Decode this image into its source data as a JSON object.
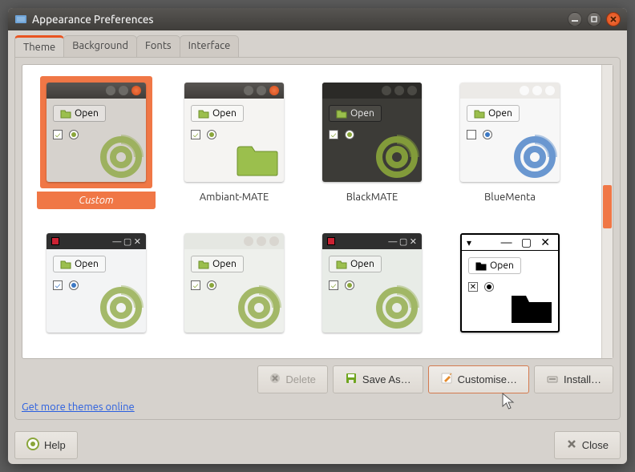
{
  "window": {
    "title": "Appearance Preferences"
  },
  "tabs": [
    {
      "label": "Theme",
      "active": true
    },
    {
      "label": "Background",
      "active": false
    },
    {
      "label": "Fonts",
      "active": false
    },
    {
      "label": "Interface",
      "active": false
    }
  ],
  "themes": [
    {
      "name": "Custom",
      "selected": true,
      "skin": "t-custom",
      "accent": "#8aa63b",
      "dark": false,
      "open_label": "Open"
    },
    {
      "name": "Ambiant-MATE",
      "selected": false,
      "skin": "t-ambiant",
      "accent": "#8aa63b",
      "dark": false,
      "open_label": "Open"
    },
    {
      "name": "BlackMATE",
      "selected": false,
      "skin": "t-black",
      "accent": "#8aa63b",
      "dark": true,
      "open_label": "Open"
    },
    {
      "name": "BlueMenta",
      "selected": false,
      "skin": "t-blue",
      "accent": "#3b78c4",
      "dark": false,
      "open_label": "Open"
    },
    {
      "name": "",
      "selected": false,
      "skin": "t-r1",
      "accent": "#8aa63b",
      "dark": false,
      "open_label": "Open"
    },
    {
      "name": "",
      "selected": false,
      "skin": "t-r2",
      "accent": "#8aa63b",
      "dark": false,
      "open_label": "Open"
    },
    {
      "name": "",
      "selected": false,
      "skin": "t-r3",
      "accent": "#8aa63b",
      "dark": false,
      "open_label": "Open"
    },
    {
      "name": "",
      "selected": false,
      "skin": "t-r4",
      "accent": "#000000",
      "dark": false,
      "open_label": "Open"
    }
  ],
  "actions": {
    "delete": "Delete",
    "save_as": "Save As…",
    "customise": "Customise…",
    "install": "Install…"
  },
  "link": "Get more themes online",
  "footer": {
    "help": "Help",
    "close": "Close"
  },
  "colors": {
    "selection": "#f07746"
  }
}
